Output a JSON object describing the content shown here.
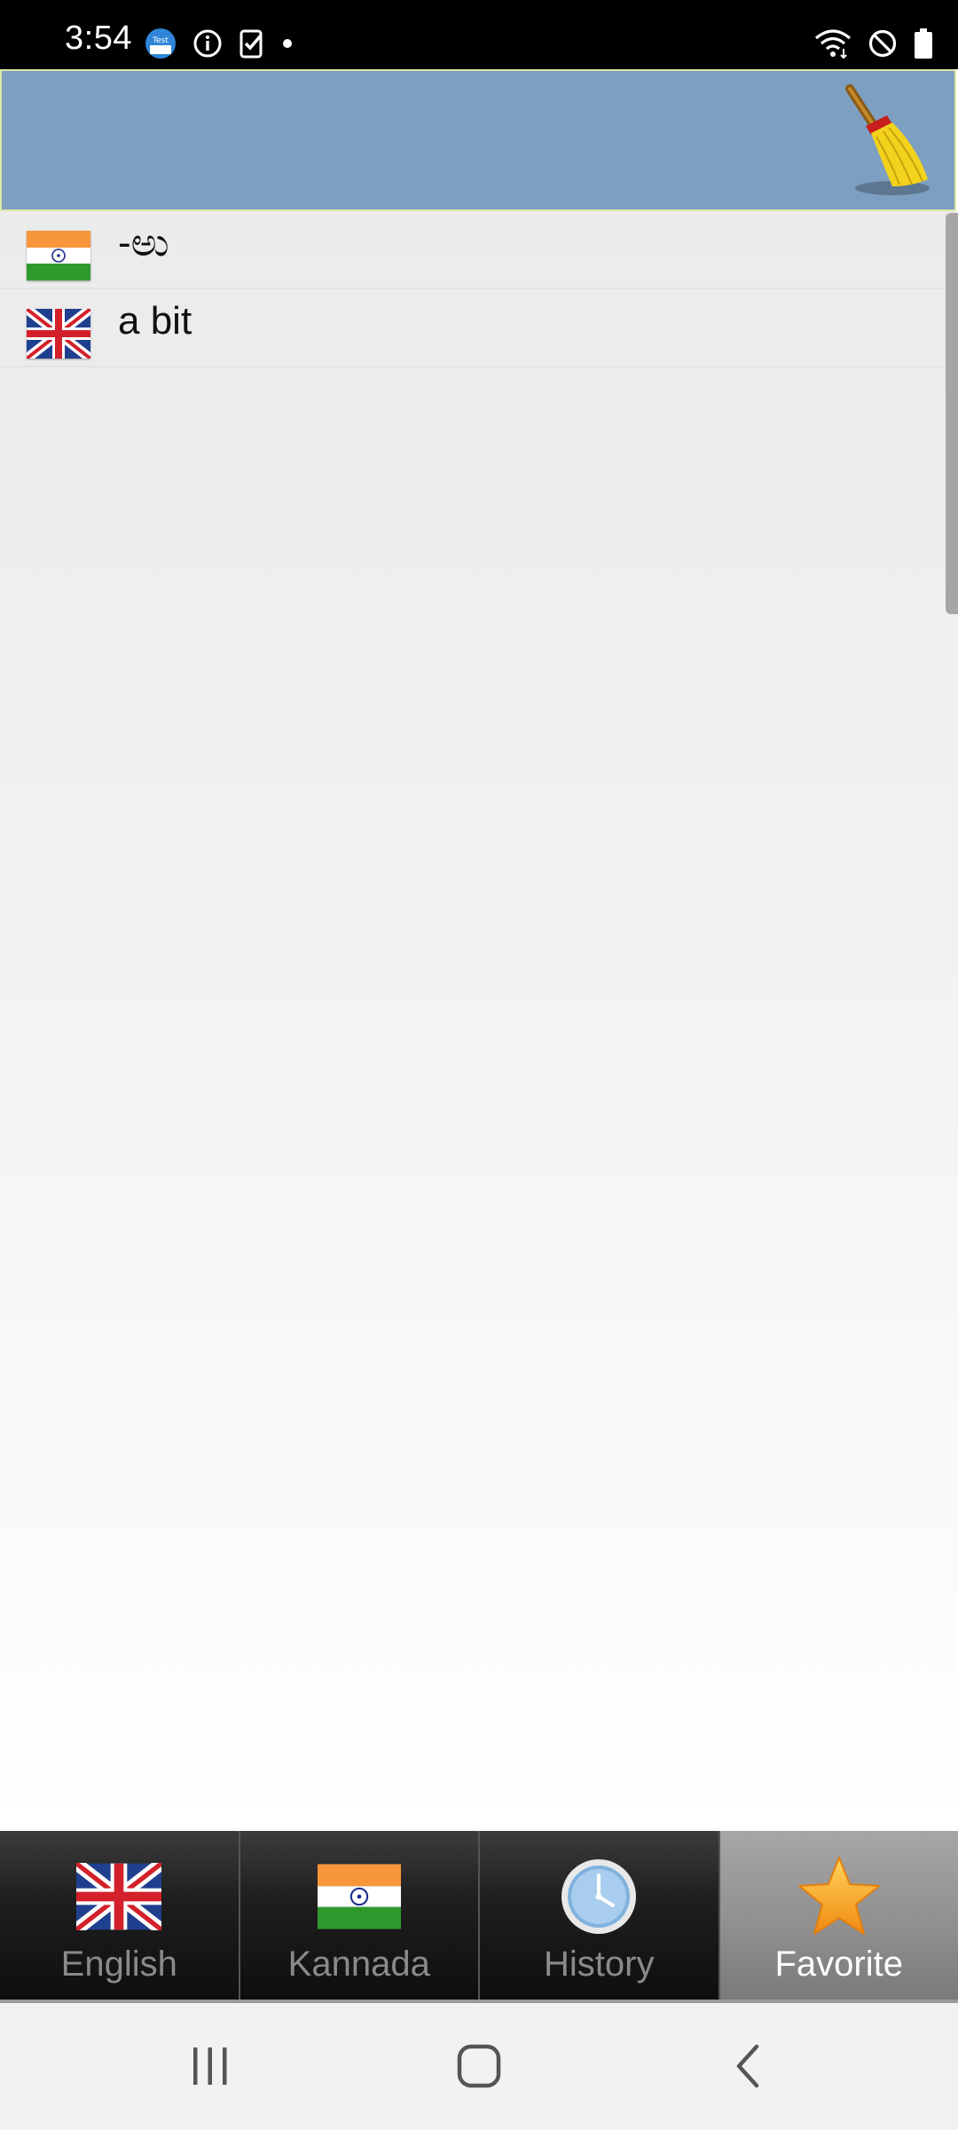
{
  "status_bar": {
    "time": "3:54",
    "left_icons": [
      "test-notification-icon",
      "info-icon",
      "clipboard-check-icon",
      "dot-icon"
    ],
    "right_icons": [
      "wifi-icon",
      "do-not-disturb-icon",
      "battery-icon"
    ]
  },
  "toolbar": {
    "background_color": "#7d9fc2",
    "clear_icon": "broom-icon"
  },
  "list": {
    "items": [
      {
        "flag": "india-flag-icon",
        "word": "-ಅು"
      },
      {
        "flag": "uk-flag-icon",
        "word": "a bit"
      }
    ]
  },
  "tabs": [
    {
      "label": "English",
      "icon": "uk-flag-icon",
      "active": false
    },
    {
      "label": "Kannada",
      "icon": "india-flag-icon",
      "active": false
    },
    {
      "label": "History",
      "icon": "clock-icon",
      "active": false
    },
    {
      "label": "Favorite",
      "icon": "star-icon",
      "active": true
    }
  ],
  "navbar": {
    "buttons": [
      "recent-apps-icon",
      "home-icon",
      "back-icon"
    ]
  }
}
